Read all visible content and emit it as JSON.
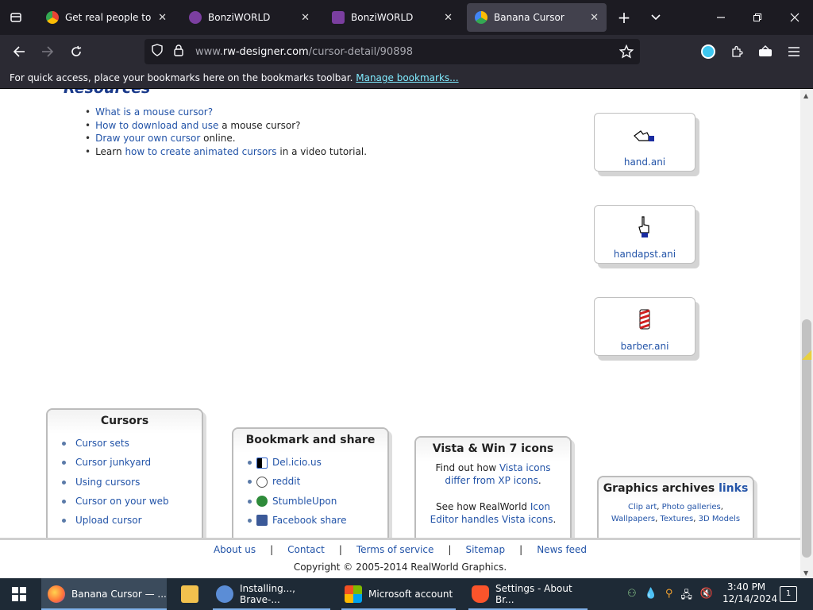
{
  "tabs": [
    {
      "title": "Get real people to take",
      "favicon_color": "#4285f4",
      "active": false
    },
    {
      "title": "BonziWORLD",
      "favicon_color": "#7b3fa0",
      "active": false
    },
    {
      "title": "BonziWORLD",
      "favicon_color": "#7b3fa0",
      "active": false
    },
    {
      "title": "Banana Cursor",
      "favicon_color": "#34a853",
      "active": true
    }
  ],
  "url": {
    "prefix": "www.",
    "domain": "rw-designer.com",
    "path": "/cursor-detail/90898"
  },
  "bookmarks_bar": {
    "text": "For quick access, place your bookmarks here on the bookmarks toolbar.",
    "link": "Manage bookmarks..."
  },
  "resources": {
    "heading": "Resources",
    "items": [
      {
        "link": "What is a mouse cursor?",
        "rest": ""
      },
      {
        "link": "How to download and use",
        "rest": " a mouse cursor?"
      },
      {
        "link": "Draw your own cursor",
        "rest": " online."
      },
      {
        "pre": "Learn ",
        "link": "how to create animated cursors",
        "rest": " in a video tutorial."
      }
    ]
  },
  "related_cursors": [
    "hand.ani",
    "handapst.ani",
    "barber.ani"
  ],
  "boxes": {
    "cursors": {
      "title": "Cursors",
      "items": [
        "Cursor sets",
        "Cursor junkyard",
        "Using cursors",
        "Cursor on your web",
        "Upload cursor"
      ]
    },
    "bookmark": {
      "title": "Bookmark and share",
      "items": [
        "Del.icio.us",
        "reddit",
        "StumbleUpon",
        "Facebook share"
      ]
    },
    "vista": {
      "title": "Vista & Win 7 icons",
      "p1_pre": "Find out how ",
      "p1_link": "Vista icons differ from XP icons",
      "p1_post": ".",
      "p2_pre": "See how RealWorld ",
      "p2_link": "Icon Editor handles Vista icons",
      "p2_post": "."
    },
    "graphics": {
      "title": "Graphics archives",
      "title_link": "links",
      "links": [
        "Clip art",
        "Photo galleries",
        "Wallpapers",
        "Textures",
        "3D Models"
      ]
    }
  },
  "footer": {
    "links": [
      "About us",
      "Contact",
      "Terms of service",
      "Sitemap",
      "News feed"
    ],
    "separator": "|",
    "copyright": "Copyright © 2005-2014 RealWorld Graphics."
  },
  "taskbar": {
    "items": [
      {
        "label": "Banana Cursor — ...",
        "icon_color": "#ff7139",
        "active": true
      },
      {
        "label": "",
        "icon_color": "#f2c14e",
        "active": false
      },
      {
        "label": "Installing..., Brave-...",
        "icon_color": "#5b8dd6",
        "active": false
      },
      {
        "label": "Microsoft account",
        "icon_color": "#f25022",
        "active": false
      },
      {
        "label": "Settings - About Br...",
        "icon_color": "#fb542b",
        "active": false
      }
    ],
    "time": "3:40 PM",
    "date": "12/14/2024",
    "notification_count": "1"
  },
  "colors": {
    "link": "#2354a8",
    "chrome_bg": "#1c1b22",
    "nav_bg": "#2b2a33",
    "taskbar_bg": "#1e2a36"
  }
}
